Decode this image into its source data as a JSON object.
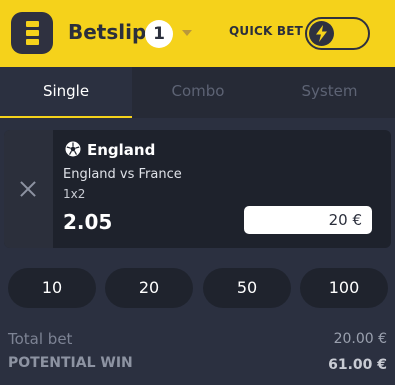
{
  "header": {
    "title": "Betslip",
    "count": "1",
    "quick_bet_label": "QUICK BET",
    "quick_bet_on": false,
    "accent_color": "#f5d21b",
    "icons": [
      "list-logo-icon",
      "chevron-down-icon",
      "lightning-icon"
    ]
  },
  "tabs": [
    {
      "label": "Single",
      "active": true
    },
    {
      "label": "Combo",
      "active": false
    },
    {
      "label": "System",
      "active": false
    }
  ],
  "selection": {
    "team": "England",
    "match": "England vs France",
    "market": "1x2",
    "odds": "2.05",
    "stake": "20 €",
    "icons": [
      "close-icon",
      "soccer-ball-icon"
    ]
  },
  "quick_stakes": [
    "10",
    "20",
    "50",
    "100"
  ],
  "summary": {
    "total_label": "Total bet",
    "total_value": "20.00 €",
    "win_label": "POTENTIAL WIN",
    "win_value": "61.00 €"
  }
}
